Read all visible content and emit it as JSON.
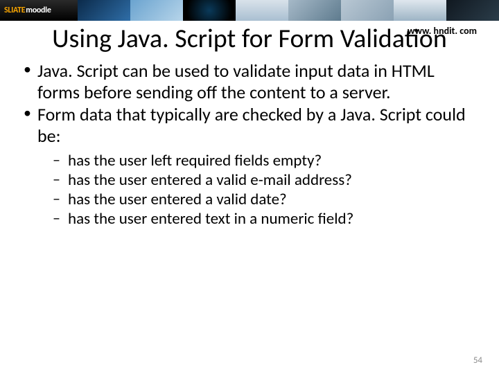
{
  "banner": {
    "brand_prefix": "SLIATE",
    "brand_suffix": "moodle"
  },
  "header": {
    "title": "Using Java. Script for Form Validation",
    "url": "www. hndit. com"
  },
  "bullets": [
    "Java. Script can be used to validate input data in HTML forms before sending off the content to a server.",
    "Form data that typically are checked by a Java. Script could be:"
  ],
  "sub_bullets": [
    "has the user left required fields empty?",
    "has the user entered a valid e-mail address?",
    "has the user entered a valid date?",
    "has the user entered text in a numeric field?"
  ],
  "page_number": "54"
}
